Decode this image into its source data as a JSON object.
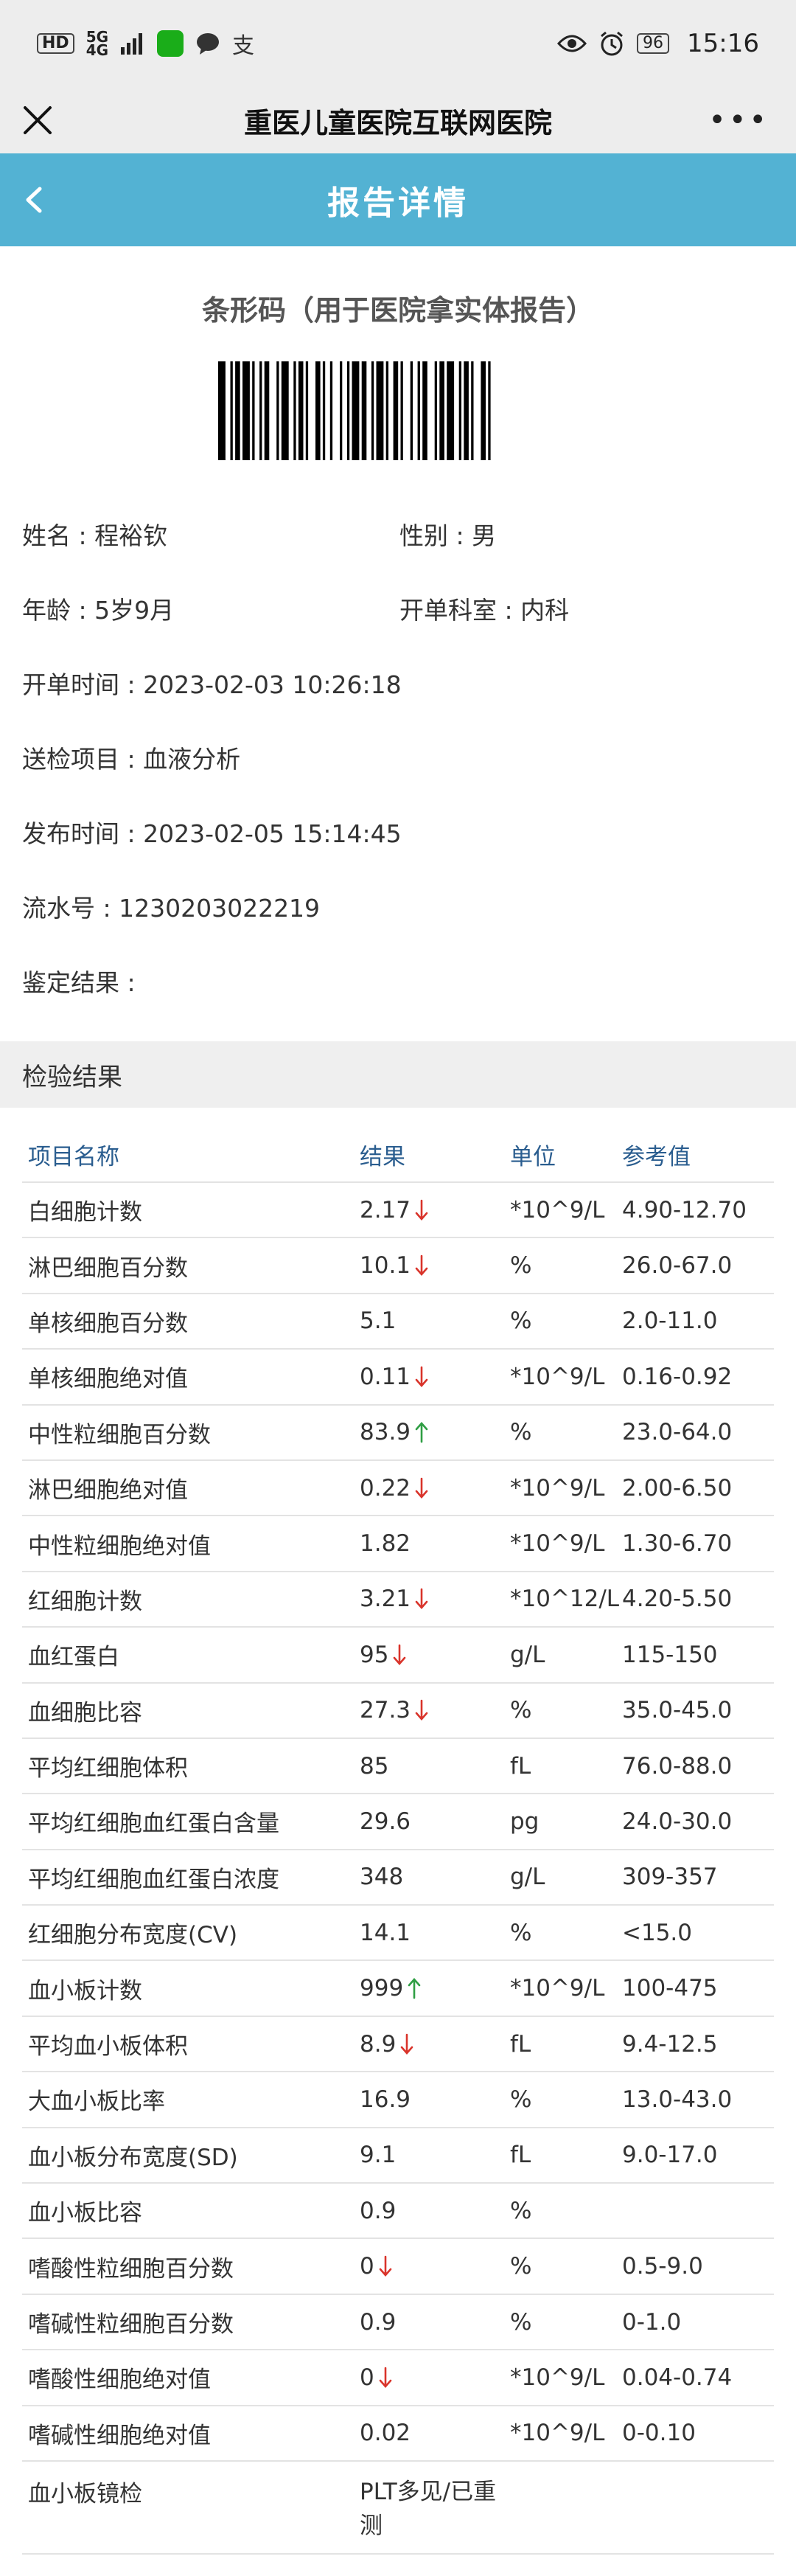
{
  "status_bar": {
    "badge": "HD",
    "network_top": "5G",
    "network_bottom": "4G",
    "battery": "96",
    "time": "15:16",
    "support_glyph": "支"
  },
  "app_bar": {
    "title": "重医儿童医院互联网医院",
    "more": "•••"
  },
  "header": {
    "title": "报告详情"
  },
  "barcode": {
    "title": "条形码（用于医院拿实体报告）"
  },
  "info": {
    "name_label": "姓名 : ",
    "name": "程裕钦",
    "gender_label": "性别 : ",
    "gender": "男",
    "age_label": "年龄 : ",
    "age": "5岁9月",
    "dept_label": "开单科室 : ",
    "dept": "内科",
    "order_time_label": "开单时间 : ",
    "order_time": "2023-02-03 10:26:18",
    "item_label": "送检项目 : ",
    "item": "血液分析",
    "publish_time_label": "发布时间 : ",
    "publish_time": "2023-02-05 15:14:45",
    "serial_label": "流水号 : ",
    "serial": "1230203022219",
    "conclusion_label": "鉴定结果 : ",
    "conclusion": ""
  },
  "section": {
    "title": "检验结果"
  },
  "table": {
    "headers": [
      "项目名称",
      "结果",
      "单位",
      "参考值"
    ],
    "colors": {
      "down": "#d9342b",
      "up": "#2f9e44"
    },
    "rows": [
      {
        "name": "白细胞计数",
        "value": "2.17",
        "flag": "down",
        "unit": "*10^9/L",
        "ref": "4.90-12.70"
      },
      {
        "name": "淋巴细胞百分数",
        "value": "10.1",
        "flag": "down",
        "unit": "%",
        "ref": "26.0-67.0"
      },
      {
        "name": "单核细胞百分数",
        "value": "5.1",
        "flag": "",
        "unit": "%",
        "ref": "2.0-11.0"
      },
      {
        "name": "单核细胞绝对值",
        "value": "0.11",
        "flag": "down",
        "unit": "*10^9/L",
        "ref": "0.16-0.92"
      },
      {
        "name": "中性粒细胞百分数",
        "value": "83.9",
        "flag": "up",
        "unit": "%",
        "ref": "23.0-64.0"
      },
      {
        "name": "淋巴细胞绝对值",
        "value": "0.22",
        "flag": "down",
        "unit": "*10^9/L",
        "ref": "2.00-6.50"
      },
      {
        "name": "中性粒细胞绝对值",
        "value": "1.82",
        "flag": "",
        "unit": "*10^9/L",
        "ref": "1.30-6.70"
      },
      {
        "name": "红细胞计数",
        "value": "3.21",
        "flag": "down",
        "unit": "*10^12/L",
        "ref": "4.20-5.50"
      },
      {
        "name": "血红蛋白",
        "value": "95",
        "flag": "down",
        "unit": "g/L",
        "ref": "115-150"
      },
      {
        "name": "血细胞比容",
        "value": "27.3",
        "flag": "down",
        "unit": "%",
        "ref": "35.0-45.0"
      },
      {
        "name": "平均红细胞体积",
        "value": "85",
        "flag": "",
        "unit": "fL",
        "ref": "76.0-88.0"
      },
      {
        "name": "平均红细胞血红蛋白含量",
        "value": "29.6",
        "flag": "",
        "unit": "pg",
        "ref": "24.0-30.0"
      },
      {
        "name": "平均红细胞血红蛋白浓度",
        "value": "348",
        "flag": "",
        "unit": "g/L",
        "ref": "309-357"
      },
      {
        "name": "红细胞分布宽度(CV)",
        "value": "14.1",
        "flag": "",
        "unit": "%",
        "ref": "<15.0"
      },
      {
        "name": "血小板计数",
        "value": "999",
        "flag": "up",
        "unit": "*10^9/L",
        "ref": "100-475"
      },
      {
        "name": "平均血小板体积",
        "value": "8.9",
        "flag": "down",
        "unit": "fL",
        "ref": "9.4-12.5"
      },
      {
        "name": "大血小板比率",
        "value": "16.9",
        "flag": "",
        "unit": "%",
        "ref": "13.0-43.0"
      },
      {
        "name": "血小板分布宽度(SD)",
        "value": "9.1",
        "flag": "",
        "unit": "fL",
        "ref": "9.0-17.0"
      },
      {
        "name": "血小板比容",
        "value": "0.9",
        "flag": "",
        "unit": "%",
        "ref": ""
      },
      {
        "name": "嗜酸性粒细胞百分数",
        "value": "0",
        "flag": "down",
        "unit": "%",
        "ref": "0.5-9.0"
      },
      {
        "name": "嗜碱性粒细胞百分数",
        "value": "0.9",
        "flag": "",
        "unit": "%",
        "ref": "0-1.0"
      },
      {
        "name": "嗜酸性细胞绝对值",
        "value": "0",
        "flag": "down",
        "unit": "*10^9/L",
        "ref": "0.04-0.74"
      },
      {
        "name": "嗜碱性细胞绝对值",
        "value": "0.02",
        "flag": "",
        "unit": "*10^9/L",
        "ref": "0-0.10"
      },
      {
        "name": "血小板镜检",
        "value": "PLT多见/已重测",
        "flag": "",
        "unit": "",
        "ref": ""
      }
    ]
  }
}
